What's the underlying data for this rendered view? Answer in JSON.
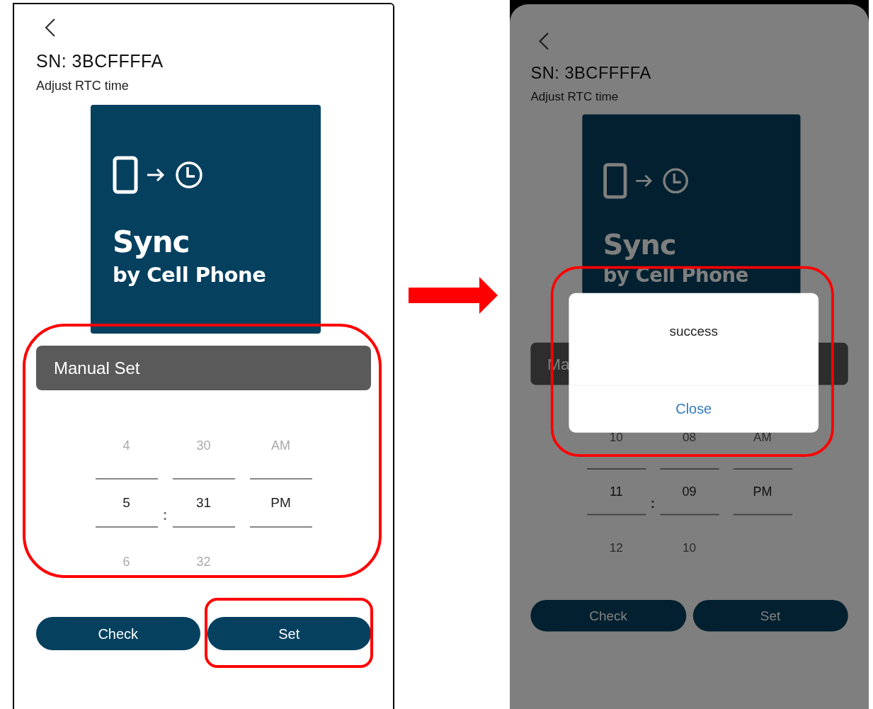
{
  "screens": [
    {
      "dimmed": false,
      "serial": "SN: 3BCFFFFA",
      "subtitle": "Adjust RTC time",
      "card": {
        "title": "Sync",
        "subtitle": "by Cell Phone"
      },
      "manual": {
        "label": "Manual Set",
        "highlighted": true,
        "separator": ":",
        "columns": [
          {
            "above": "4",
            "value": "5",
            "below": "6"
          },
          {
            "above": "30",
            "value": "31",
            "below": "32"
          },
          {
            "above": "AM",
            "value": "PM"
          }
        ]
      },
      "buttons": [
        {
          "label": "Check",
          "highlighted": false
        },
        {
          "label": "Set",
          "highlighted": true
        }
      ]
    },
    {
      "dimmed": true,
      "serial": "SN: 3BCFFFFA",
      "subtitle": "Adjust RTC time",
      "card": {
        "title": "Sync",
        "subtitle": "by Cell Phone"
      },
      "manual": {
        "label": "Ma",
        "highlighted": false,
        "separator": ":",
        "columns": [
          {
            "above": "10",
            "value": "11",
            "below": "12"
          },
          {
            "above": "08",
            "value": "09",
            "below": "10"
          },
          {
            "above": "AM",
            "value": "PM"
          }
        ]
      },
      "buttons": [
        {
          "label": "Check",
          "highlighted": false
        },
        {
          "label": "Set",
          "highlighted": false
        }
      ],
      "dialog": {
        "message": "success",
        "button": "Close",
        "highlighted": true
      }
    }
  ]
}
